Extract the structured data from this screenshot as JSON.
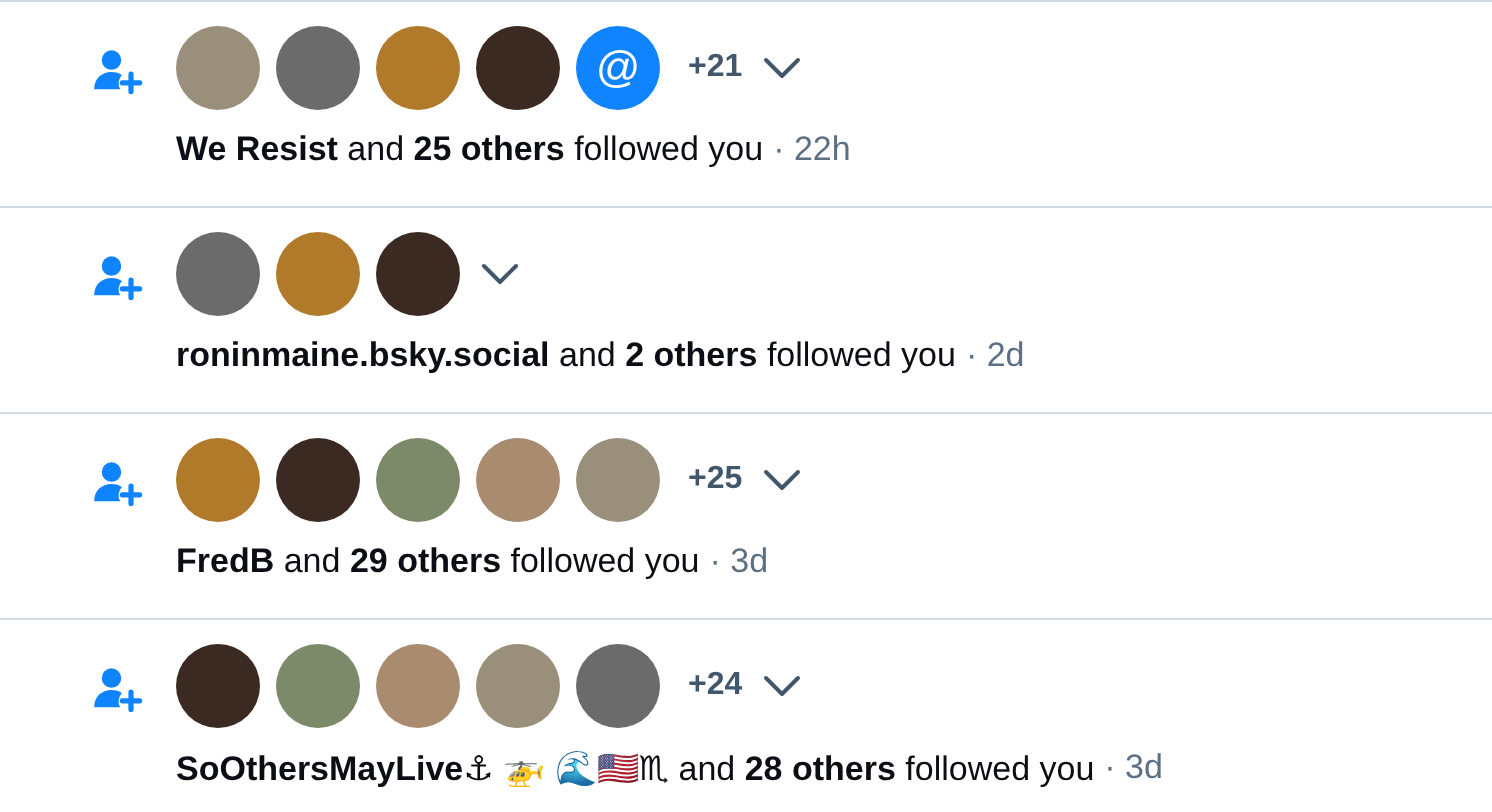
{
  "notifications": [
    {
      "avatars": [
        {
          "kind": "photo"
        },
        {
          "kind": "photo"
        },
        {
          "kind": "photo"
        },
        {
          "kind": "photo"
        },
        {
          "kind": "default",
          "glyph": "@"
        }
      ],
      "more": "+21",
      "text": "**We Resist** and **25 others** followed you",
      "time": "· 22h"
    },
    {
      "avatars": [
        {
          "kind": "photo"
        },
        {
          "kind": "photo"
        },
        {
          "kind": "photo"
        }
      ],
      "text": "**roninmaine.bsky.social** and **2 others** followed you",
      "time": "· 2d"
    },
    {
      "avatars": [
        {
          "kind": "photo"
        },
        {
          "kind": "photo"
        },
        {
          "kind": "photo"
        },
        {
          "kind": "photo"
        },
        {
          "kind": "photo"
        }
      ],
      "more": "+25",
      "text": "**FredB** and **29 others** followed you",
      "time": "· 3d"
    },
    {
      "avatars": [
        {
          "kind": "photo"
        },
        {
          "kind": "photo"
        },
        {
          "kind": "photo"
        },
        {
          "kind": "photo"
        },
        {
          "kind": "photo"
        }
      ],
      "more": "+24",
      "text": "**SoOthersMayLive⚓ 🚁 🌊🇺🇸♏** and **28 others** followed you",
      "time": "· 3d"
    }
  ]
}
